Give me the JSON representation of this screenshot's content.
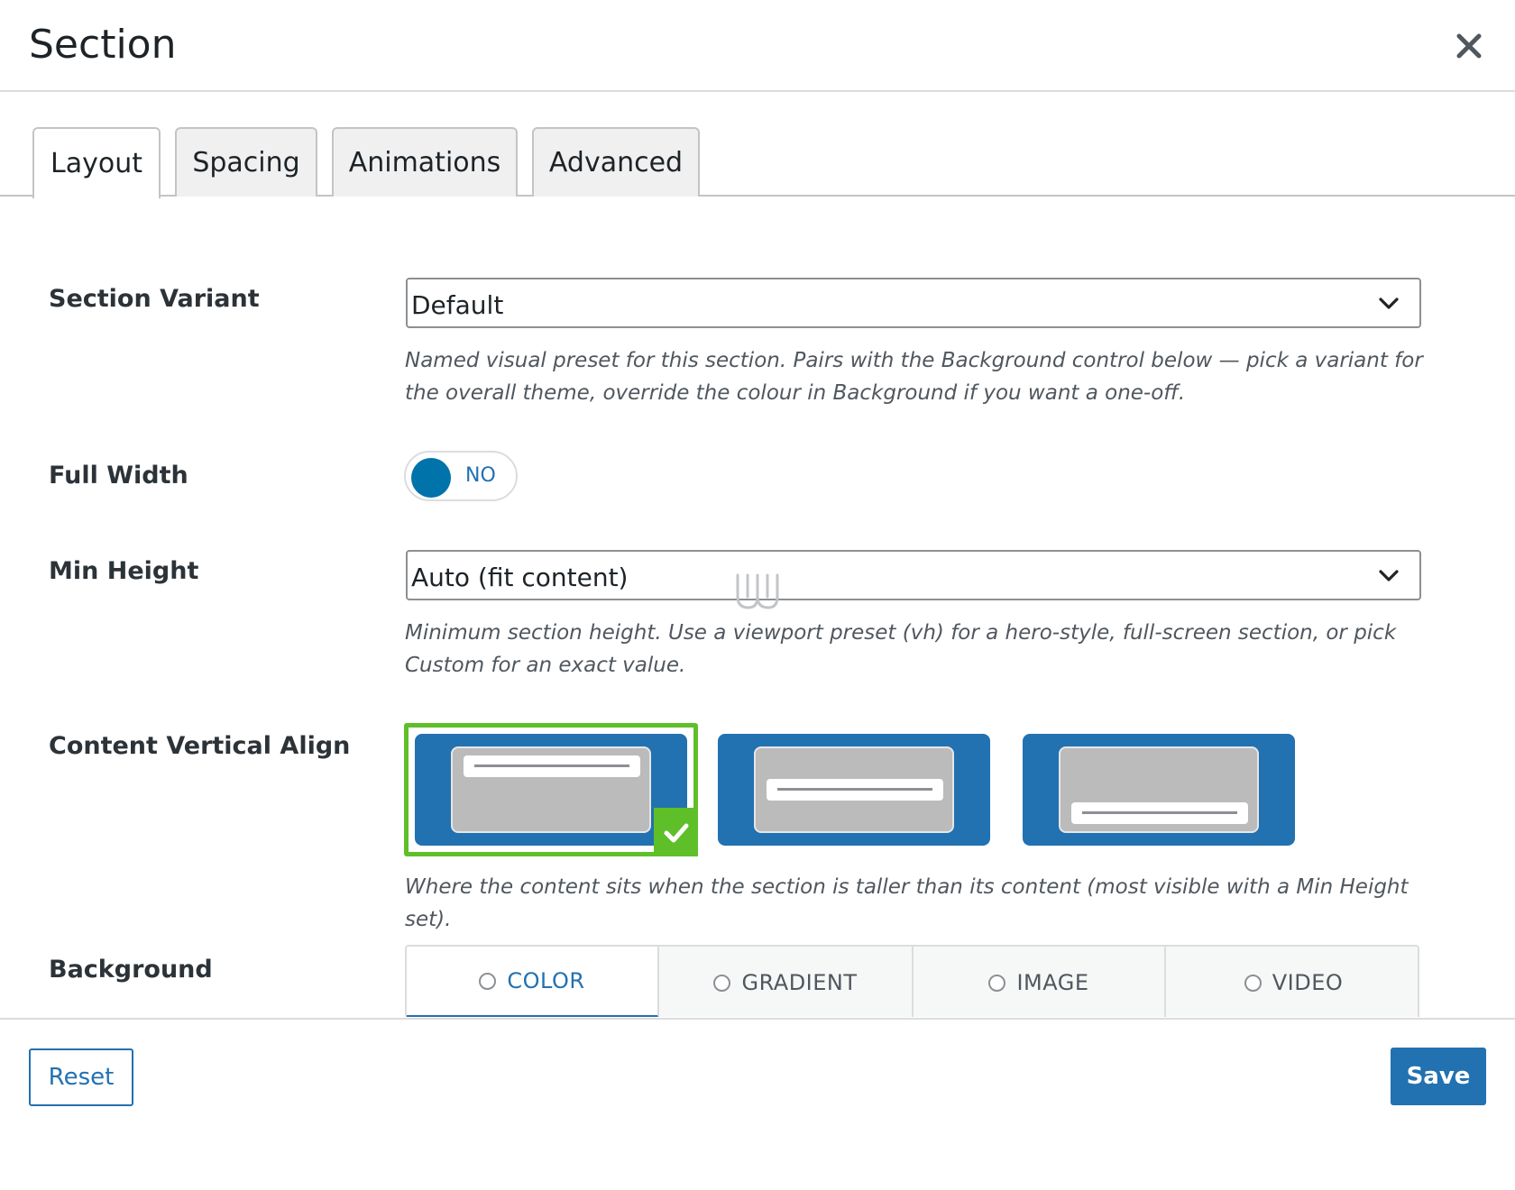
{
  "dialog": {
    "title": "Section",
    "close_icon": "close-icon"
  },
  "tabs": [
    {
      "label": "Layout",
      "active": true
    },
    {
      "label": "Spacing",
      "active": false
    },
    {
      "label": "Animations",
      "active": false
    },
    {
      "label": "Advanced",
      "active": false
    }
  ],
  "fields": {
    "section_variant": {
      "label": "Section Variant",
      "value": "Default",
      "help": "Named visual preset for this section. Pairs with the Background control below — pick a variant for the overall theme, override the colour in Background if you want a one-off."
    },
    "full_width": {
      "label": "Full Width",
      "toggle_text": "NO",
      "enabled": false
    },
    "min_height": {
      "label": "Min Height",
      "value": "Auto (fit content)",
      "help": "Minimum section height. Use a viewport preset (vh) for a hero-style, full-screen section, or pick Custom for an exact value."
    },
    "content_vertical_align": {
      "label": "Content Vertical Align",
      "options": [
        "top",
        "middle",
        "bottom"
      ],
      "selected": "top",
      "help": "Where the content sits when the section is taller than its content (most visible with a Min Height set)."
    },
    "background": {
      "label": "Background",
      "tabs": [
        "COLOR",
        "GRADIENT",
        "IMAGE",
        "VIDEO"
      ],
      "active": "COLOR"
    }
  },
  "footer": {
    "reset_label": "Reset",
    "save_label": "Save"
  },
  "colors": {
    "accent": "#2271b1",
    "toggle_knob": "#0073aa",
    "selected_green": "#5fbf28"
  }
}
